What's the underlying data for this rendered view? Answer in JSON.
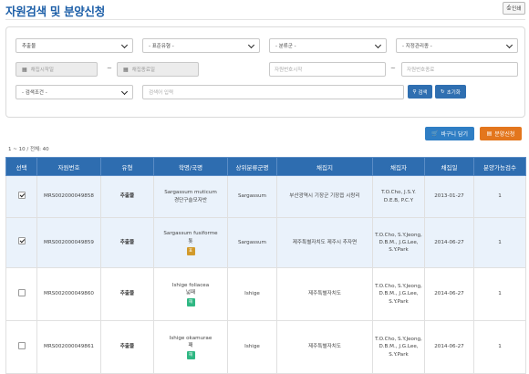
{
  "header": {
    "title": "자원검색 및 분양신청",
    "print_label": "인쇄"
  },
  "search": {
    "type_select": "추출물",
    "standard_type_select": "- 표준유형 -",
    "category_select": "- 분류군 -",
    "manager_select": "- 지정관리종 -",
    "date_start_placeholder": "채집시작일",
    "date_end_placeholder": "채집종료일",
    "resource_start_placeholder": "자원번호시작",
    "resource_end_placeholder": "자원번호종료",
    "condition_select": "- 검색조건 -",
    "keyword_placeholder": "검색어 입력",
    "search_button": "검색",
    "reset_button": "초기화",
    "tilde": "~"
  },
  "actions": {
    "basket_button": "바구니 담기",
    "request_button": "분양신청"
  },
  "result": {
    "count_text": "1 ~ 10 / 전체: 40"
  },
  "table": {
    "headers": [
      "선택",
      "자원번호",
      "유형",
      "학명/국명",
      "상위분류군명",
      "채집지",
      "채집자",
      "채집일",
      "분양가능검수"
    ],
    "rows": [
      {
        "checked": true,
        "id": "MRS002000049858",
        "type": "추출물",
        "sci": "Sargassum muticum",
        "kor": "경단구슬모자반",
        "tag": "",
        "tag_color": "",
        "upper": "Sargassum",
        "place": "부산광역시 기장군 기장읍 시랑리",
        "collector": "T.O.Cho, J.S.Y. D.E.B, P.C.Y",
        "date": "2013-01-27",
        "qty": "1"
      },
      {
        "checked": true,
        "id": "MRS002000049859",
        "type": "추출물",
        "sci": "Sargassum fusiforme",
        "kor": "톳",
        "tag": "표",
        "tag_color": "#d29a2b",
        "upper": "Sargassum",
        "place": "제주특별자치도 제주시 추자면",
        "collector": "T.O.Cho, S.Y.Jeong, D.B.M., J.G.Lee, S.Y.Park",
        "date": "2014-06-27",
        "qty": "1"
      },
      {
        "checked": false,
        "id": "MRS002000049860",
        "type": "추출물",
        "sci": "Ishige foliacea",
        "kor": "넓패",
        "tag": "해",
        "tag_color": "#2fb783",
        "upper": "Ishige",
        "place": "제주특별자치도",
        "collector": "T.O.Cho, S.Y.Jeong, D.B.M., J.G.Lee, S.Y.Park",
        "date": "2014-06-27",
        "qty": "1"
      },
      {
        "checked": false,
        "id": "MRS002000049861",
        "type": "추출물",
        "sci": "Ishige okamurae",
        "kor": "패",
        "tag": "해",
        "tag_color": "#2fb783",
        "upper": "Ishige",
        "place": "제주특별자치도",
        "collector": "T.O.Cho, S.Y.Jeong, D.B.M., J.G.Lee, S.Y.Park",
        "date": "2014-06-27",
        "qty": "1"
      }
    ]
  },
  "colors": {
    "title": "#1d5fa8",
    "header_bg": "#2e6db0",
    "basket_btn": "#2f7ec4",
    "request_btn": "#e3761d"
  }
}
